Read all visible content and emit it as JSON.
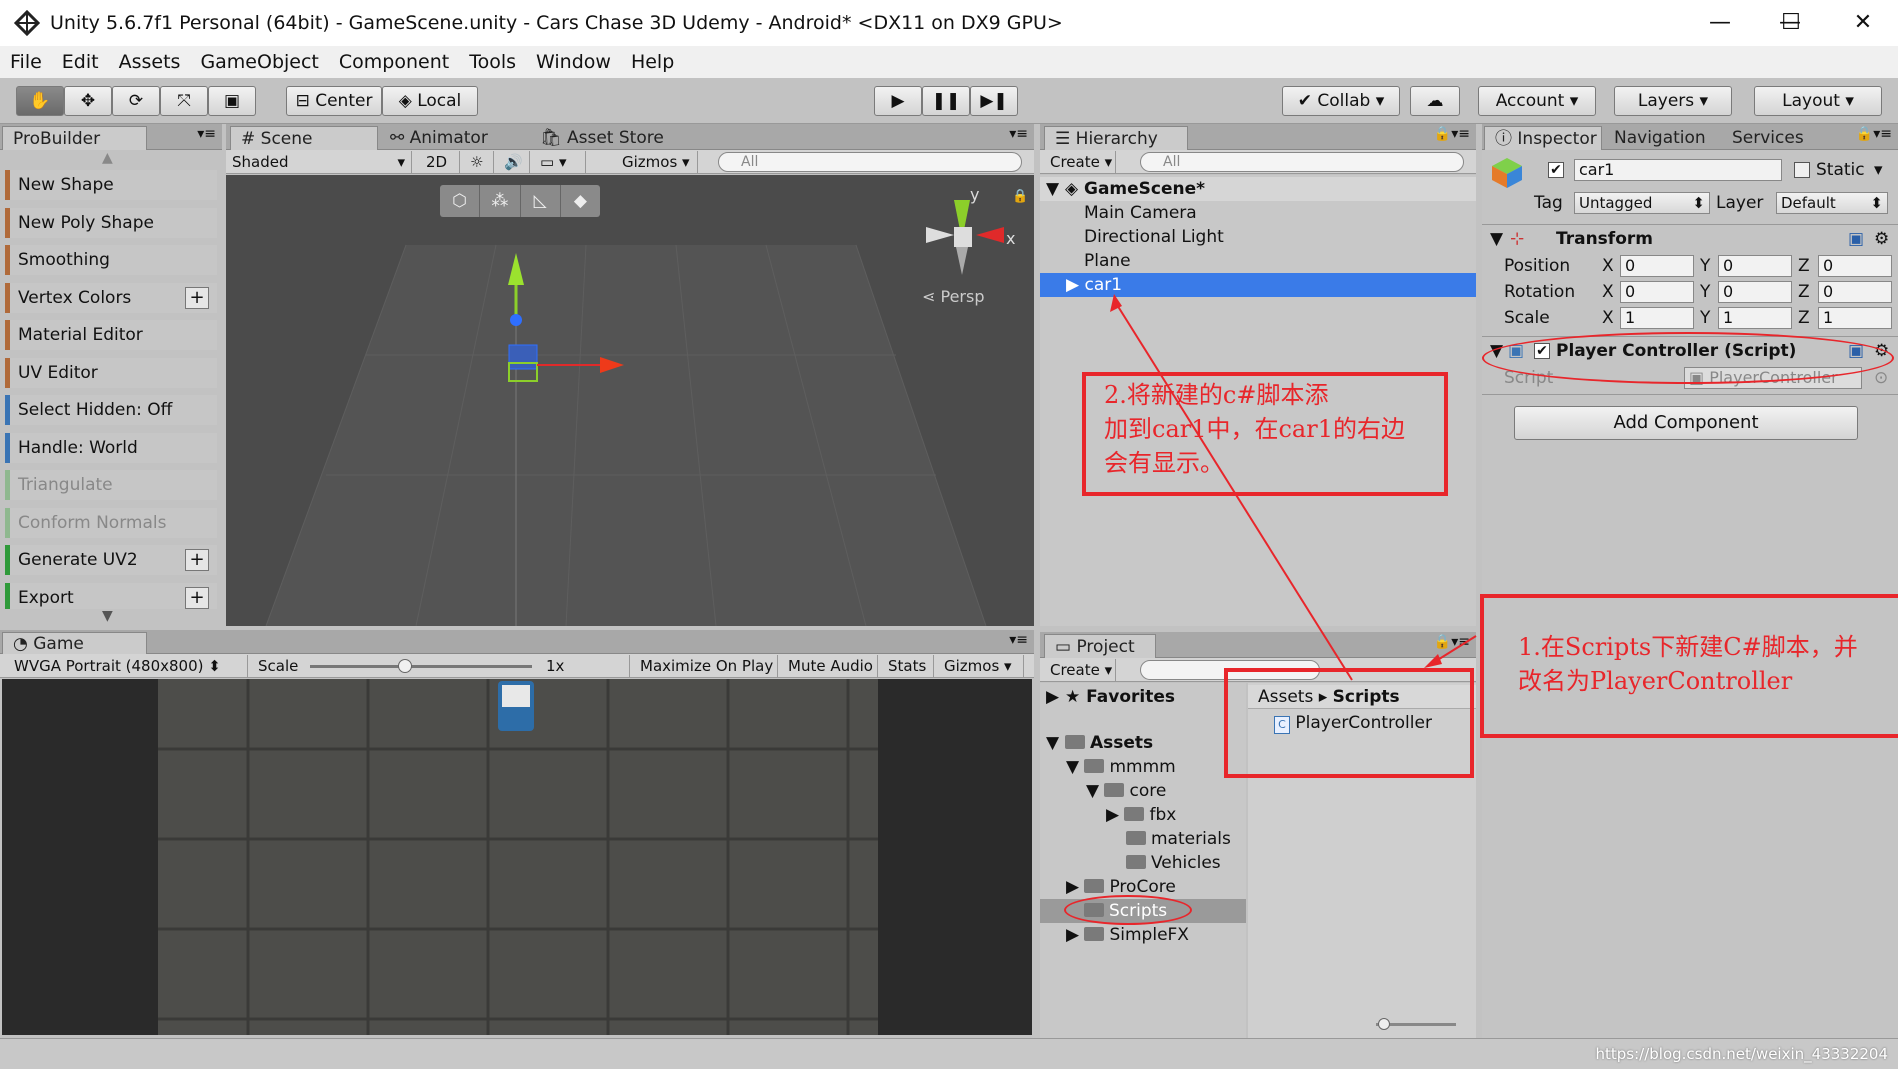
{
  "window": {
    "title": "Unity 5.6.7f1 Personal (64bit) - GameScene.unity - Cars Chase 3D Udemy - Android* <DX11 on DX9 GPU>",
    "minimize": "—",
    "maximize": "☐",
    "close": "✕"
  },
  "menu": [
    "File",
    "Edit",
    "Assets",
    "GameObject",
    "Component",
    "Tools",
    "Window",
    "Help"
  ],
  "toolbar": {
    "center": "Center",
    "local": "Local",
    "collab": "Collab ▾",
    "account": "Account",
    "layers": "Layers",
    "layout": "Layout"
  },
  "probuilder": {
    "tab": "ProBuilder",
    "items": [
      {
        "label": "New Shape"
      },
      {
        "label": "New Poly Shape"
      },
      {
        "label": "Smoothing"
      },
      {
        "label": "Vertex Colors"
      },
      {
        "label": "Material Editor"
      },
      {
        "label": "UV Editor"
      },
      {
        "label": "Select Hidden: Off"
      },
      {
        "label": "Handle: World"
      },
      {
        "label": "Triangulate"
      },
      {
        "label": "Conform Normals"
      },
      {
        "label": "Generate UV2"
      },
      {
        "label": "Export"
      }
    ]
  },
  "scene": {
    "tabs": [
      "Scene",
      "Animator",
      "Asset Store"
    ],
    "shaded": "Shaded",
    "mode2d": "2D",
    "gizmos": "Gizmos ▾",
    "search": "All",
    "persp": "Persp",
    "axis_x": "x",
    "axis_y": "y"
  },
  "game": {
    "tab": "Game",
    "resolution": "WVGA Portrait (480x800)",
    "scale_label": "Scale",
    "scale_value": "1x",
    "maximize": "Maximize On Play",
    "mute": "Mute Audio",
    "stats": "Stats",
    "gizmos": "Gizmos ▾"
  },
  "hierarchy": {
    "tab": "Hierarchy",
    "create": "Create ▾",
    "search": "All",
    "scene_name": "GameScene*",
    "items": [
      "Main Camera",
      "Directional Light",
      "Plane",
      "car1"
    ]
  },
  "project": {
    "tab": "Project",
    "create": "Create ▾",
    "favorites": "Favorites",
    "assets": "Assets",
    "tree": [
      "mmmm",
      "core",
      "fbx",
      "materials",
      "Vehicles",
      "ProCore",
      "Scripts",
      "SimpleFX"
    ],
    "breadcrumb_root": "Assets",
    "breadcrumb_current": "Scripts",
    "file": "PlayerController"
  },
  "inspector": {
    "tabs": [
      "Inspector",
      "Navigation",
      "Services"
    ],
    "object_name": "car1",
    "static_label": "Static",
    "tag_label": "Tag",
    "tag_value": "Untagged",
    "layer_label": "Layer",
    "layer_value": "Default",
    "transform": {
      "title": "Transform",
      "position_label": "Position",
      "rotation_label": "Rotation",
      "scale_label": "Scale",
      "position": [
        "0",
        "0",
        "0"
      ],
      "rotation": [
        "0",
        "0",
        "0"
      ],
      "scale": [
        "1",
        "1",
        "1"
      ]
    },
    "component": {
      "title": "Player Controller (Script)",
      "script_label": "Script",
      "script_value": "PlayerController"
    },
    "add_component": "Add Component"
  },
  "annotations": {
    "note1_line1": "1.在Scripts下新建C#脚本，并",
    "note1_line2": "改名为PlayerController",
    "note2_line1": "2.将新建的c#脚本添",
    "note2_line2": "加到car1中，在car1的右边",
    "note2_line3": "会有显示。"
  },
  "watermark": "https://blog.csdn.net/weixin_43332204",
  "colors": {
    "annotation": "#e8262b",
    "selection": "#3a7be8"
  }
}
